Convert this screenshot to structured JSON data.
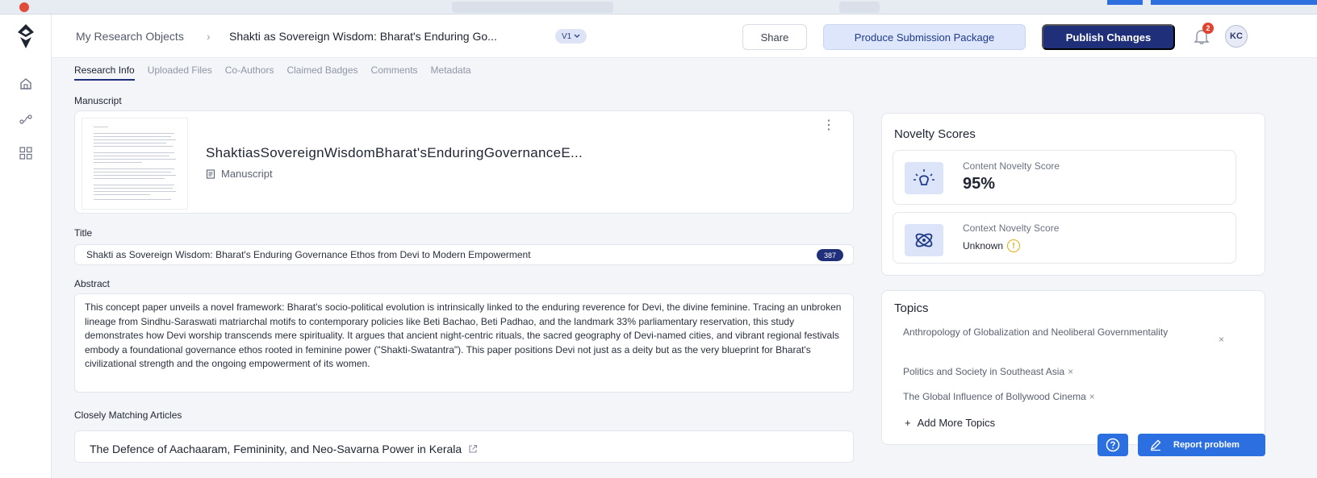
{
  "breadcrumb": {
    "root": "My Research Objects",
    "separator": "›",
    "current": "Shakti as Sovereign Wisdom: Bharat's Enduring Go...",
    "version": "V1"
  },
  "header": {
    "share_label": "Share",
    "produce_label": "Produce Submission Package",
    "publish_label": "Publish Changes",
    "notification_count": "2",
    "avatar_initials": "KC"
  },
  "tabs": [
    {
      "label": "Research Info",
      "active": true
    },
    {
      "label": "Uploaded Files",
      "active": false
    },
    {
      "label": "Co-Authors",
      "active": false
    },
    {
      "label": "Claimed Badges",
      "active": false
    },
    {
      "label": "Comments",
      "active": false
    },
    {
      "label": "Metadata",
      "active": false
    }
  ],
  "manuscript": {
    "section_label": "Manuscript",
    "file_name": "ShaktiasSovereignWisdomBharat'sEnduringGovernanceE...",
    "file_type": "Manuscript",
    "menu_icon": "more-vertical-icon"
  },
  "title_field": {
    "label": "Title",
    "value": "Shakti as Sovereign Wisdom: Bharat's Enduring Governance Ethos from Devi to Modern Empowerment",
    "char_count": "387"
  },
  "abstract": {
    "label": "Abstract",
    "text": "This concept paper unveils a novel framework: Bharat's socio-political evolution is intrinsically linked to the enduring reverence for Devi, the divine feminine. Tracing an unbroken lineage from Sindhu-Saraswati matriarchal motifs to contemporary policies like Beti Bachao, Beti Padhao, and the landmark 33% parliamentary reservation, this study demonstrates how Devi worship transcends mere spirituality. It argues that ancient night-centric rituals, the sacred geography of Devi-named cities, and vibrant regional festivals embody a foundational governance ethos rooted in feminine power (\"Shakti-Swatantra\"). This paper positions Devi not just as a deity but as the very blueprint for Bharat's civilizational strength and the ongoing empowerment of its women."
  },
  "matching_articles": {
    "label": "Closely Matching Articles",
    "items": [
      {
        "title": "The Defence of Aachaaram, Femininity, and Neo-Savarna Power in Kerala"
      }
    ]
  },
  "novelty": {
    "title": "Novelty Scores",
    "content": {
      "label": "Content Novelty Score",
      "value": "95%"
    },
    "context": {
      "label": "Context Novelty Score",
      "value": "Unknown",
      "warning_symbol": "!"
    }
  },
  "topics": {
    "title": "Topics",
    "items": [
      "Anthropology of Globalization and Neoliberal Governmentality",
      "Politics and Society in Southeast Asia",
      "The Global Influence of Bollywood Cinema"
    ],
    "remove_symbol": "×",
    "add_label": "Add More Topics",
    "add_symbol": "+"
  },
  "footer": {
    "report_label": "Report problem"
  },
  "colors": {
    "primary": "#1f2f7a",
    "accent_blue": "#2c6fe0",
    "notification": "#e1432e",
    "warning": "#e0a800"
  }
}
